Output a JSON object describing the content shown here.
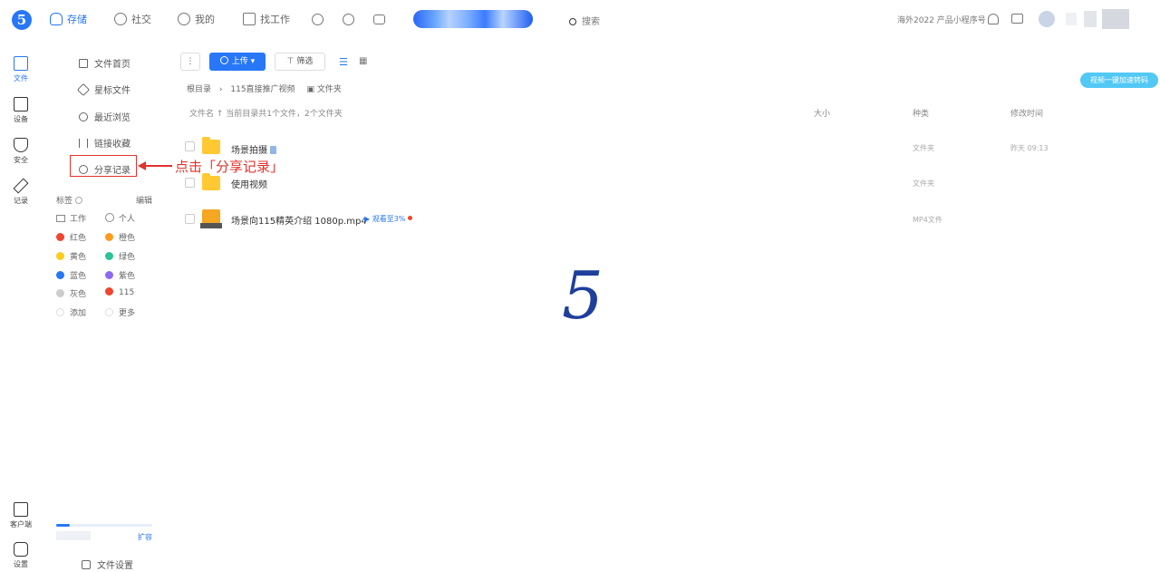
{
  "topbar": {
    "logo": "5",
    "nav": [
      {
        "label": "存储",
        "icon": "cloud-icon"
      },
      {
        "label": "社交",
        "icon": "clock-icon"
      },
      {
        "label": "我的",
        "icon": "heart-icon"
      },
      {
        "label": "找工作",
        "icon": "briefcase-icon"
      }
    ],
    "search_label": "搜索",
    "right_text": "海外2022 产品小程序号"
  },
  "rail": {
    "items": [
      {
        "label": "文件",
        "icon": "files-icon"
      },
      {
        "label": "设备",
        "icon": "devices-icon"
      },
      {
        "label": "安全",
        "icon": "shield-icon"
      },
      {
        "label": "记录",
        "icon": "edit-icon"
      }
    ],
    "bottom": [
      {
        "label": "客户端",
        "icon": "client-icon"
      },
      {
        "label": "设置",
        "icon": "settings-icon"
      }
    ]
  },
  "sidebar": {
    "items": [
      {
        "label": "文件首页",
        "icon": "document-icon"
      },
      {
        "label": "星标文件",
        "icon": "star-icon"
      },
      {
        "label": "最近浏览",
        "icon": "history-icon"
      },
      {
        "label": "链接收藏",
        "icon": "link-icon"
      },
      {
        "label": "分享记录",
        "icon": "share-record-icon"
      }
    ],
    "tags_header": "标签",
    "tags_manage": "编辑",
    "tags": [
      {
        "label": "工作",
        "color": "#999999",
        "shape": "folder"
      },
      {
        "label": "个人",
        "color": "#999999",
        "shape": "user"
      },
      {
        "label": "红色",
        "color": "#f0452e"
      },
      {
        "label": "橙色",
        "color": "#ff9a1f"
      },
      {
        "label": "黄色",
        "color": "#ffcb1f"
      },
      {
        "label": "绿色",
        "color": "#2cc39a"
      },
      {
        "label": "蓝色",
        "color": "#2777f8"
      },
      {
        "label": "紫色",
        "color": "#8a6cf0"
      },
      {
        "label": "灰色",
        "color": "#cccccc"
      },
      {
        "label": "115",
        "color": "#f0452e"
      },
      {
        "label": "添加",
        "color": "#ffffff"
      },
      {
        "label": "更多",
        "color": "#ffffff"
      }
    ],
    "storage_upgrade": "扩容",
    "file_settings": "文件设置"
  },
  "toolbar": {
    "upload_label": "上传",
    "filter_label": "筛选"
  },
  "breadcrumb": {
    "root": "根目录",
    "current": "115直接推广视频",
    "folder_label": "文件夹"
  },
  "table": {
    "summary": "文件名 ↑  当前目录共1个文件，2个文件夹",
    "col_size": "大小",
    "col_type": "种类",
    "col_modified": "修改时间",
    "rows": [
      {
        "name": "场景拍摄",
        "type": "文件夹",
        "modified": "昨天 09:13"
      },
      {
        "name": "使用视频",
        "type": "文件夹",
        "modified": ""
      },
      {
        "name": "场景向115精英介绍 1080p.mp4",
        "progress": "观看至3%",
        "type": "MP4文件",
        "modified": ""
      }
    ]
  },
  "annotation": "点击「分享记录」",
  "promo": "视频一键加速转码",
  "brand_mark": "5"
}
